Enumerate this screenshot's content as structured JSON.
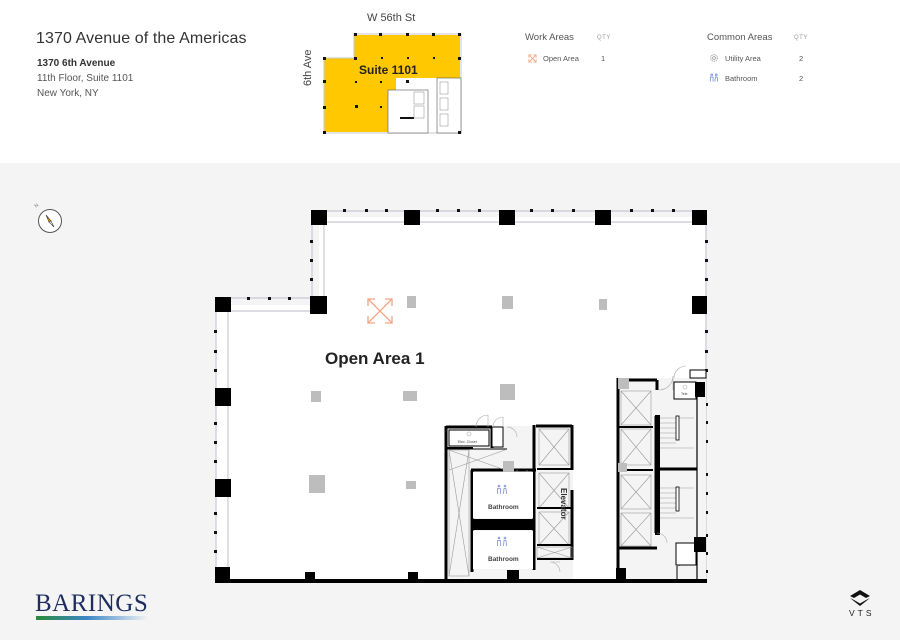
{
  "property": {
    "title": "1370 Avenue of the Americas",
    "address_line1": "1370 6th Avenue",
    "address_line2": "11th Floor, Suite 1101",
    "address_line3": "New York, NY"
  },
  "keyplan": {
    "street_top": "W 56th St",
    "street_left": "6th Ave",
    "suite_label": "Suite 1101",
    "highlight_color": "#ffc800"
  },
  "legend": {
    "work_areas": {
      "title": "Work Areas",
      "qty_header": "QTY",
      "items": [
        {
          "label": "Open Area",
          "qty": "1",
          "icon": "open-area-icon",
          "color": "#f4a582"
        }
      ]
    },
    "common_areas": {
      "title": "Common Areas",
      "qty_header": "QTY",
      "items": [
        {
          "label": "Utility Area",
          "qty": "2",
          "icon": "gear-icon",
          "color": "#999999"
        },
        {
          "label": "Bathroom",
          "qty": "2",
          "icon": "bathroom-icon",
          "color": "#7b8fe0"
        }
      ]
    }
  },
  "compass": {
    "label": "N"
  },
  "floorplan": {
    "open_area_label": "Open Area 1",
    "elec_closet_label": "Elec. Closet",
    "tele_label": "Tele.",
    "bathroom_1_label": "Bathroom",
    "bathroom_2_label": "Bathroom",
    "elevator_label": "Elevator"
  },
  "branding": {
    "client_logo": "BARINGS",
    "platform_logo": "VTS"
  }
}
